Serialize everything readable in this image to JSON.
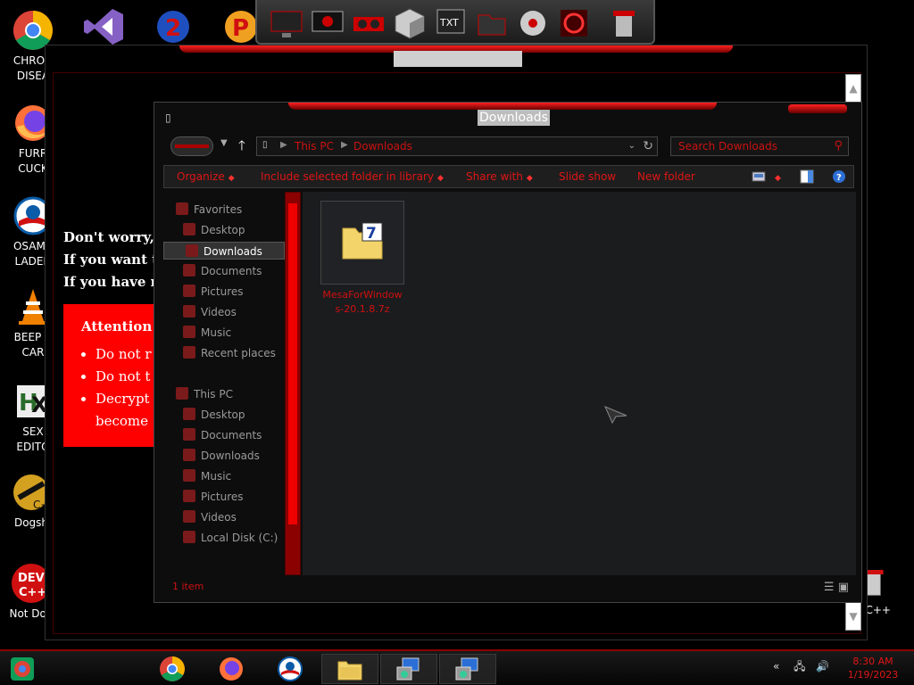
{
  "desktop": {
    "icons": [
      {
        "label": "CHRON\nDISEA",
        "icon": "chrome-icon"
      },
      {
        "label": "FURR\nCUCK",
        "icon": "firefox-icon"
      },
      {
        "label": "OSAMA\nLADEN",
        "icon": "obama-logo-icon"
      },
      {
        "label": "BEEP B\nCAR",
        "icon": "vlc-cone-icon"
      },
      {
        "label": "SEX\nEDITO",
        "icon": "hex-editor-icon"
      },
      {
        "label": "Dogsh",
        "icon": "codeblocks-icon"
      },
      {
        "label": "Not Dog",
        "icon": "devcpp-icon"
      },
      {
        "label": "n C++",
        "icon": "recycle-bin-icon"
      }
    ]
  },
  "ransom": {
    "lines": [
      "Don't worry,y",
      "If you want to",
      "If you have no"
    ],
    "attention_title": "Attention!",
    "bullets": [
      "Do not r",
      "Do not t",
      "Decrypt",
      "become"
    ]
  },
  "explorer": {
    "title": "Downloads",
    "address": {
      "segments": [
        "This PC",
        "Downloads"
      ]
    },
    "search_placeholder": "Search Downloads",
    "toolbar": {
      "organize": "Organize",
      "include": "Include selected folder in library",
      "share": "Share with",
      "slideshow": "Slide show",
      "new_folder": "New folder"
    },
    "nav": {
      "favorites": "Favorites",
      "fav_items": [
        "Desktop",
        "Downloads",
        "Documents",
        "Pictures",
        "Videos",
        "Music",
        "Recent places"
      ],
      "this_pc": "This PC",
      "pc_items": [
        "Desktop",
        "Documents",
        "Downloads",
        "Music",
        "Pictures",
        "Videos",
        "Local Disk (C:)"
      ]
    },
    "files": [
      {
        "name": "MesaForWindows-20.1.8.7z"
      }
    ],
    "status": "1 item"
  },
  "taskbar": {
    "clock_time": "8:30 AM",
    "clock_date": "1/19/2023"
  },
  "colors": {
    "accent": "#e01515",
    "window_bg": "#1b1c1e",
    "attention": "#ff0000"
  }
}
